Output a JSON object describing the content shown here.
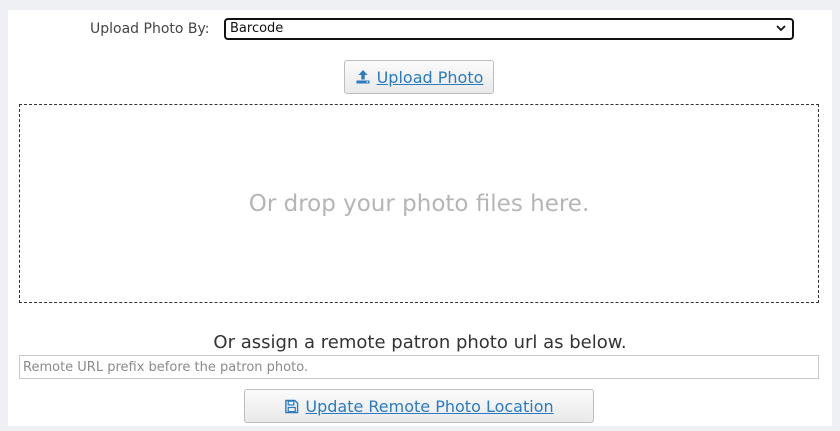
{
  "upload_by": {
    "label": "Upload Photo By:",
    "selected": "Barcode"
  },
  "upload_button": {
    "label": "Upload Photo",
    "icon": "upload-icon"
  },
  "dropzone": {
    "text": "Or drop your photo files here."
  },
  "remote": {
    "heading": "Or assign a remote patron photo url as below.",
    "placeholder": "Remote URL prefix before the patron photo.",
    "value": ""
  },
  "update_button": {
    "label": "Update Remote Photo Location",
    "icon": "save-icon"
  },
  "colors": {
    "link_blue": "#2a7bc0",
    "background": "#eef0f3",
    "drop_text": "#b5b5b5"
  }
}
